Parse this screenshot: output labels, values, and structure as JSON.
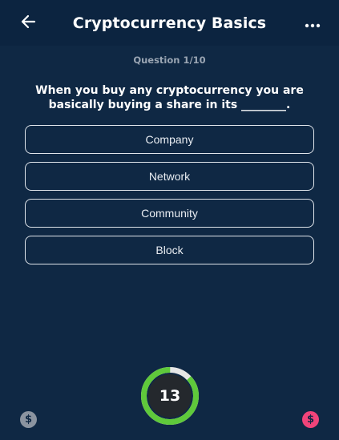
{
  "header": {
    "title": "Cryptocurrency Basics",
    "back_icon": "arrow-left-icon",
    "menu_icon": "more-horizontal-icon"
  },
  "quiz": {
    "counter": "Question 1/10",
    "question": "When you buy any cryptocurrency you are basically buying a share in its ________.",
    "options": [
      {
        "label": "Company"
      },
      {
        "label": "Network"
      },
      {
        "label": "Community"
      },
      {
        "label": "Block"
      }
    ]
  },
  "timer": {
    "value": "13",
    "remaining_fraction": 0.87,
    "ring_color": "#5fc93b",
    "track_color": "#e6e6e6"
  },
  "footer": {
    "left_icon": "dollar-coin-icon",
    "right_icon": "dollar-coin-icon",
    "left_glyph": "$",
    "right_glyph": "$",
    "left_color": "#8b94a0",
    "right_color": "#f0447a"
  }
}
